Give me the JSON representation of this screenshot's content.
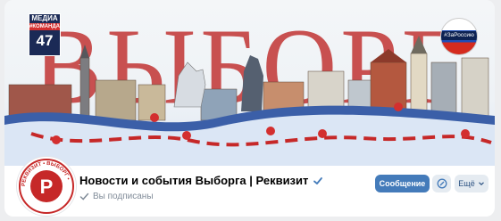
{
  "cover": {
    "media_logo": {
      "line1": "МЕДИА",
      "line2": "#КОМАНДА",
      "line3": "47"
    },
    "headline": "ВЫБОРГ",
    "tag_badge": "#ЗаРоссию"
  },
  "header": {
    "title": "Новости и события Выборга | Реквизит",
    "subscribed_text": "Вы подписаны",
    "avatar_ring_text": "РЕКВИЗИТ • ВЫБОРГ •"
  },
  "actions": {
    "message_label": "Сообщение",
    "more_label": "Ещё"
  },
  "colors": {
    "accent": "#447bba",
    "brand_red": "#c62828",
    "headline_red": "#c85050"
  },
  "icons": {
    "verified": "verified-check-icon",
    "subscribed": "check-icon",
    "circle_button": "notification-icon",
    "more": "chevron-down-icon"
  }
}
